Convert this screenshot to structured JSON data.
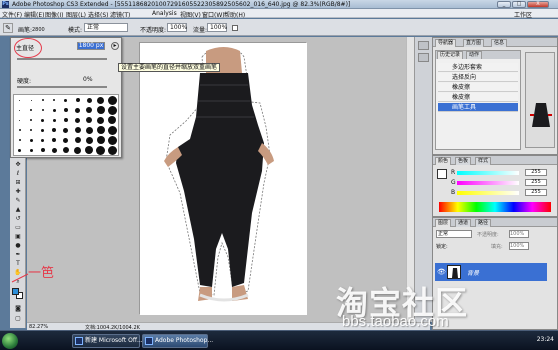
{
  "window": {
    "title": "Adobe Photoshop CS3 Extended - [5551186820100729160552230589250560­2_016_640.jpg @ 82.3%(RGB/8#)]",
    "app_icon": "Ps",
    "buttons": {
      "minimize": "_",
      "maximize": "□",
      "close": "X"
    }
  },
  "menubar": {
    "items": [
      "文件(F)",
      "编辑(E)",
      "图像(I)",
      "图层(L)",
      "选择(S)",
      "滤镜(T)",
      "Analysis",
      "视图(V)",
      "窗口(W)",
      "帮助(H)"
    ],
    "workspace": "工作区"
  },
  "options": {
    "brush_label": "画笔:",
    "brush_size": "2800",
    "mode_label": "模式:",
    "mode_value": "正常",
    "opacity_label": "不透明度:",
    "opacity_value": "100%",
    "flow_label": "流量:",
    "flow_value": "100%"
  },
  "brush_popup": {
    "diameter_label": "主直径",
    "diameter_value": "1800 px",
    "hardness_label": "硬度:",
    "hardness_value": "0%",
    "tooltip": "设置主要画笔的直径并缩放双重画笔",
    "brush_sizes": [
      1,
      1,
      2,
      2,
      3,
      4,
      5,
      7,
      9,
      1,
      2,
      2,
      3,
      4,
      5,
      6,
      8,
      9,
      1,
      2,
      3,
      3,
      4,
      5,
      6,
      7,
      8,
      2,
      2,
      3,
      4,
      5,
      6,
      7,
      8,
      9,
      2,
      3,
      3,
      4,
      5,
      6,
      7,
      8,
      9,
      3,
      3,
      4,
      5,
      6,
      7,
      8,
      9,
      9
    ]
  },
  "annotation": {
    "text": "一笆"
  },
  "status": {
    "zoom": "82.27%",
    "doc_size": "文档:1004.2K/1004.2K"
  },
  "history_panel": {
    "tabs": [
      "导航器",
      "直方图",
      "信息"
    ],
    "sub_tabs": [
      "历史记录",
      "动作"
    ],
    "items": [
      "多边形套索",
      "选择反向",
      "橡皮擦",
      "橡皮擦",
      "画笔工具"
    ],
    "selected_index": 4
  },
  "color_panel": {
    "tabs": [
      "颜色",
      "色板",
      "样式"
    ],
    "channels": [
      {
        "label": "R",
        "value": "255"
      },
      {
        "label": "G",
        "value": "255"
      },
      {
        "label": "B",
        "value": "255"
      }
    ]
  },
  "layers_panel": {
    "tabs": [
      "图层",
      "通道",
      "路径"
    ],
    "blend_mode": "正常",
    "opacity_label": "不透明度:",
    "opacity_value": "100%",
    "lock_label": "锁定:",
    "fill_label": "填充:",
    "fill_value": "100%",
    "layer_name": "背景"
  },
  "taskbar": {
    "tasks": [
      "新建 Microsoft Off...",
      "Adobe Photoshop..."
    ],
    "clock": "23:24"
  },
  "watermark": {
    "logo": "淘宝社区",
    "url": "bbs.taobao.com"
  },
  "colors": {
    "accent": "#3a70d3",
    "annotation": "#e53a4a",
    "foreground": "#2c8ed8"
  }
}
